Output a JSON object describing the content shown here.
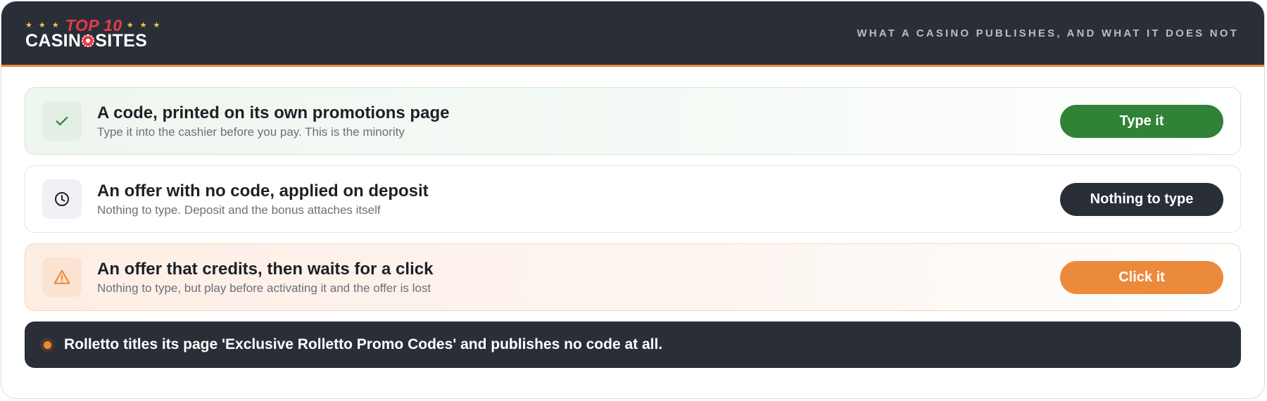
{
  "header": {
    "logo": {
      "top_text": "TOP 10",
      "bottom_text_left": "CASIN",
      "bottom_text_right": "SITES",
      "stars": "★ ★ ★"
    },
    "tagline": "WHAT A CASINO PUBLISHES, AND WHAT IT DOES NOT"
  },
  "rows": [
    {
      "icon": "check-icon",
      "title": "A code, printed on its own promotions page",
      "subtitle": "Type it into the cashier before you pay. This is the minority",
      "button": "Type it"
    },
    {
      "icon": "clock-icon",
      "title": "An offer with no code, applied on deposit",
      "subtitle": "Nothing to type. Deposit and the bonus attaches itself",
      "button": "Nothing to type"
    },
    {
      "icon": "warning-icon",
      "title": "An offer that credits, then waits for a click",
      "subtitle": "Nothing to type, but play before activating it and the offer is lost",
      "button": "Click it"
    }
  ],
  "note": "Rolletto titles its page 'Exclusive Rolletto Promo Codes' and publishes no code at all.",
  "colors": {
    "header_bg": "#2a2e37",
    "accent_orange": "#ec8a3b",
    "accent_green": "#2f8236",
    "logo_red": "#e63a4a"
  }
}
